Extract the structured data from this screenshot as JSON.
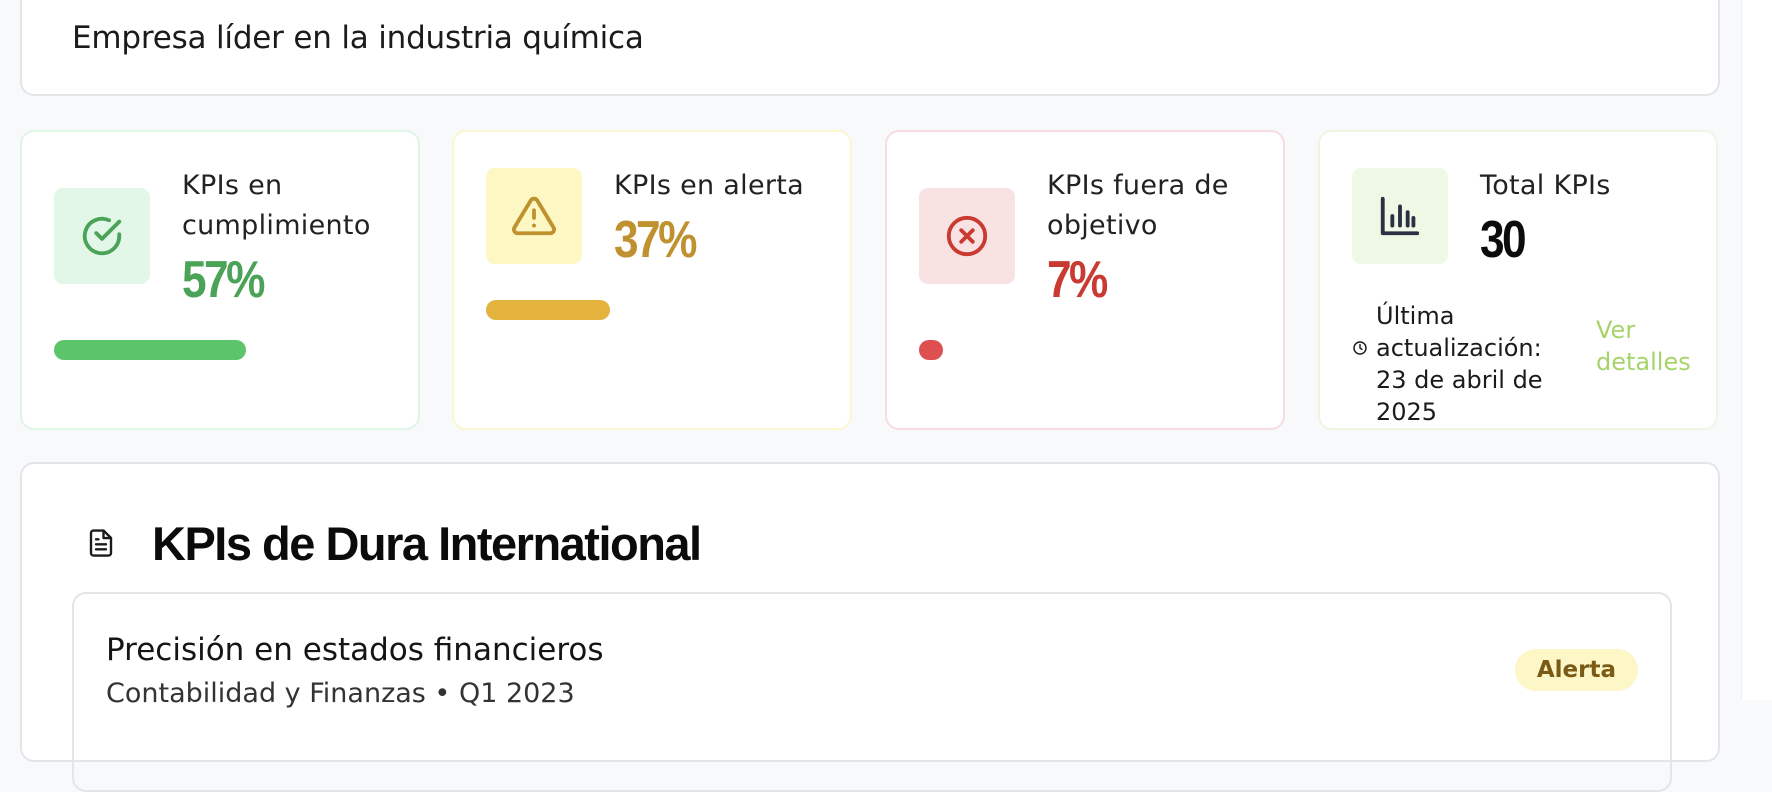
{
  "company": {
    "subtitle": "Empresa líder en la industria química"
  },
  "kpis": {
    "compliance": {
      "label": "KPIs en cumplimiento",
      "value": "57%",
      "progress": 0.57,
      "icon": "check-circle-icon",
      "color": "#4aa357"
    },
    "alert": {
      "label": "KPIs en alerta",
      "value": "37%",
      "progress": 0.37,
      "icon": "warning-triangle-icon",
      "color": "#c0912f"
    },
    "off_target": {
      "label": "KPIs fuera de objetivo",
      "value": "7%",
      "progress": 0.07,
      "icon": "x-circle-icon",
      "color": "#c93a33"
    },
    "total": {
      "label": "Total KPIs",
      "value": "30",
      "icon": "bar-chart-icon",
      "updated": "Última actualización: 23 de abril de 2025",
      "details_link": "Ver detalles"
    }
  },
  "section": {
    "title": "KPIs de Dura International",
    "icon": "document-icon",
    "items": [
      {
        "title": "Precisión en estados financieros",
        "area": "Contabilidad y Finanzas",
        "period": "Q1 2023",
        "meta": "Contabilidad y Finanzas • Q1 2023",
        "status": "Alerta"
      }
    ]
  }
}
